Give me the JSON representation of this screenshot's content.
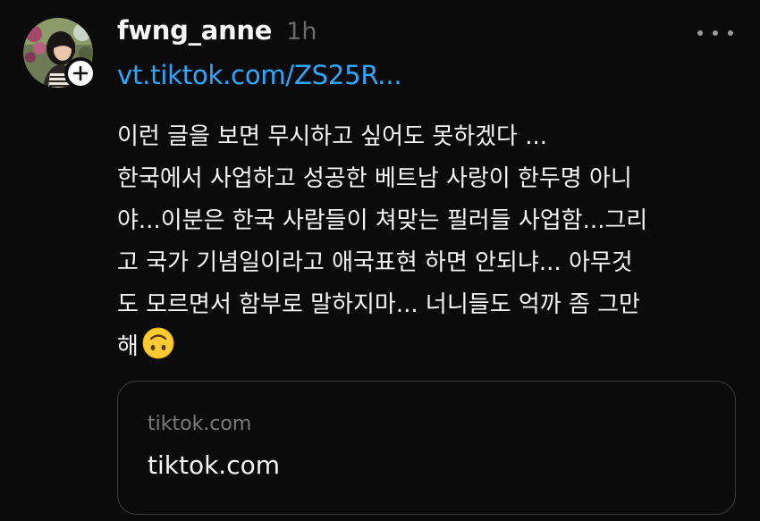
{
  "post": {
    "username": "fwng_anne",
    "timestamp": "1h",
    "link": "vt.tiktok.com/ZS25R...",
    "body_lines": [
      "이런 글을 보면 무시하고 싶어도 못하겠다 ...",
      "한국에서 사업하고 성공한 베트남 사랑이 한두명 아니",
      "야...이분은 한국 사람들이 쳐맞는 필러들 사업함...그리",
      "고 국가 기념일이라고 애국표현 하면 안되냐... 아무것",
      "도 모르면서 함부로 말하지마... 너니들도 억까 좀 그만",
      "해"
    ],
    "trailing_emoji": "upside-down-face-emoji"
  },
  "link_card": {
    "domain": "tiktok.com",
    "title": "tiktok.com"
  },
  "icons": {
    "avatar": "profile-photo",
    "follow": "plus-icon",
    "more": "more-horizontal-icon"
  },
  "colors": {
    "background": "#0b0b0b",
    "link": "#2ea8ff",
    "muted": "#6b6b6b",
    "card_border": "#3c3c3c"
  }
}
